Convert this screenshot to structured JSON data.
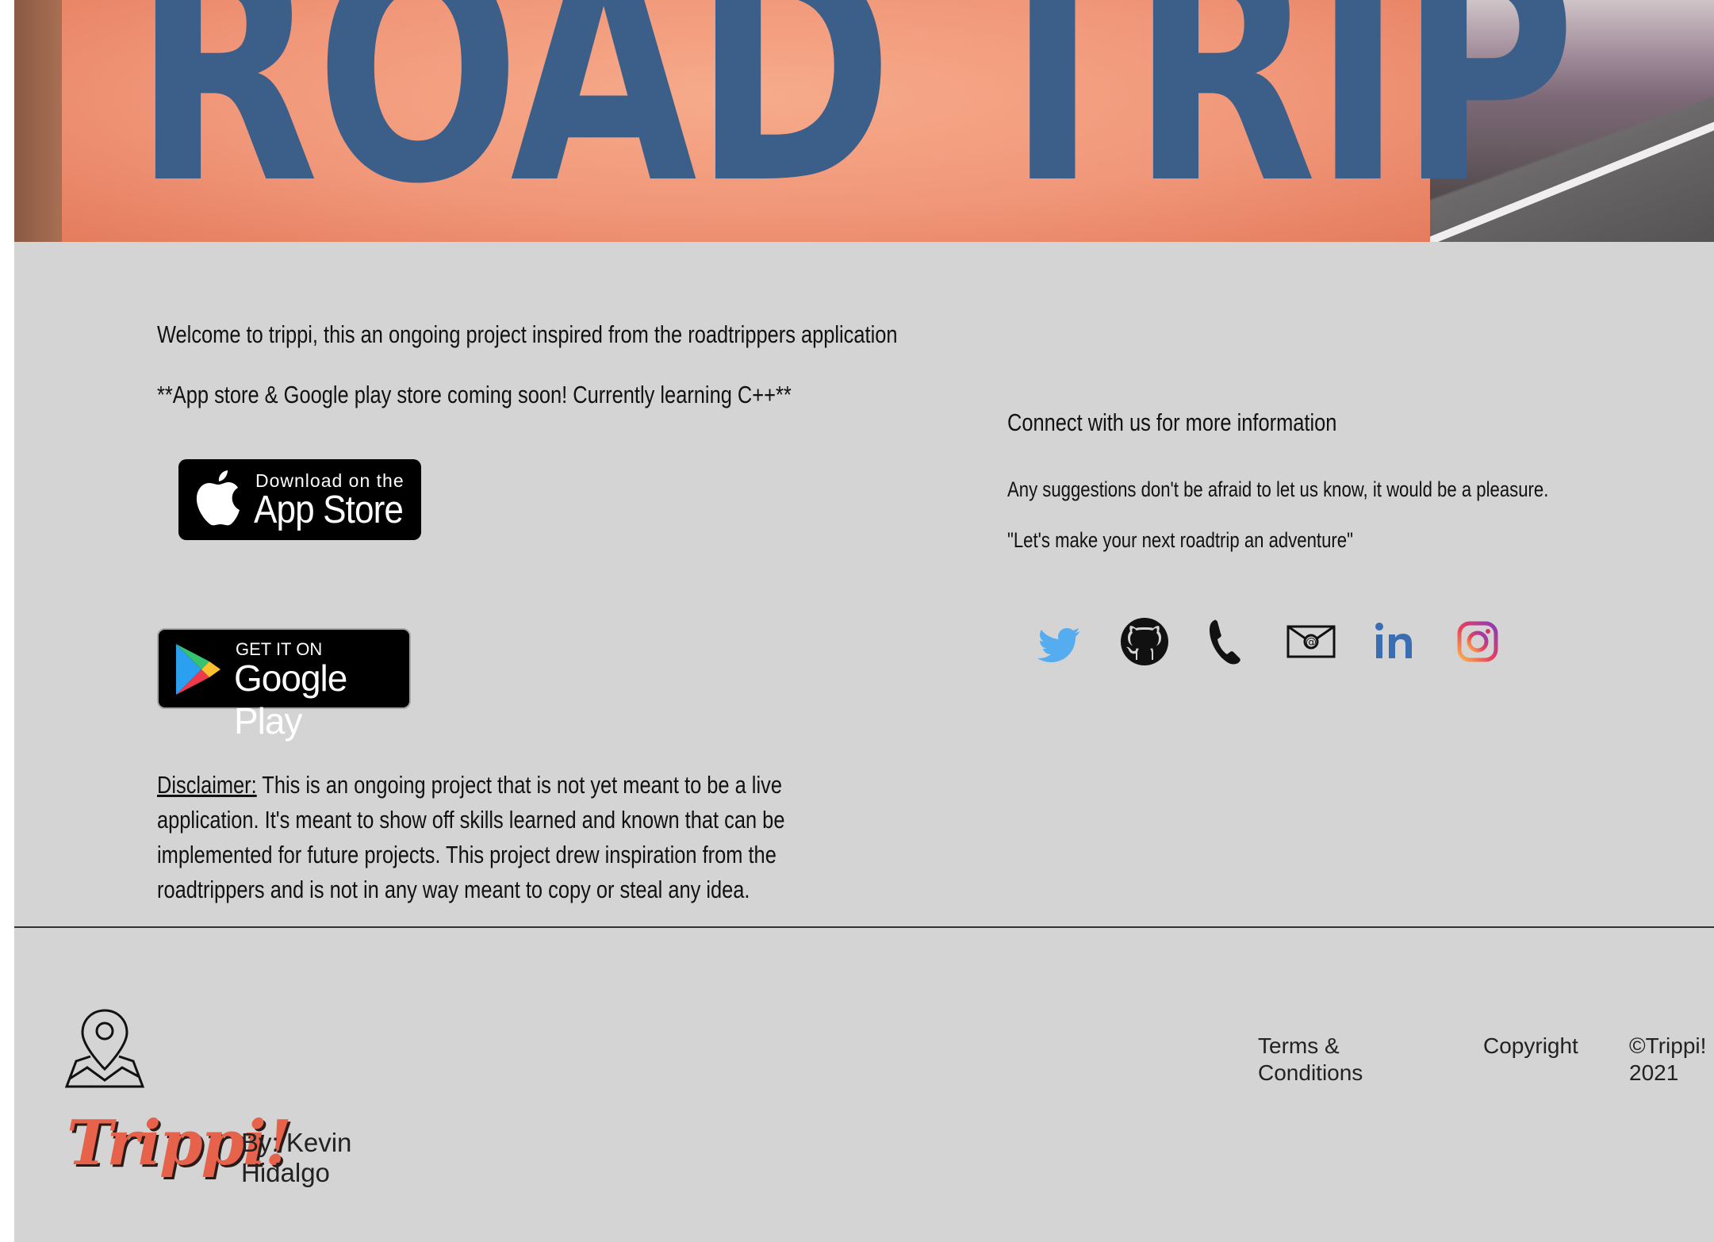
{
  "hero": {
    "banner_text": "ROAD TRIP"
  },
  "intro": {
    "welcome": "Welcome to trippi, this an ongoing project inspired from the roadtrippers application",
    "coming_soon": "**App store & Google play store coming soon! Currently learning C++**"
  },
  "badges": {
    "app_store": {
      "small": "Download on the",
      "big": "App Store"
    },
    "google_play": {
      "small": "GET IT ON",
      "big": "Google Play"
    }
  },
  "disclaimer": {
    "label": "Disclaimer:",
    "text": " This is an ongoing project that is not yet meant to be a live application. It's meant to show off skills learned and known that can be implemented for future projects. This project drew inspiration from the roadtrippers and is not in any way meant to copy or steal any idea."
  },
  "connect": {
    "heading": "Connect with us for more information",
    "suggestions": "Any suggestions don't be afraid to let us know, it would be a pleasure.",
    "quote": "\"Let's make your next roadtrip an adventure\""
  },
  "social": [
    {
      "icon": "twitter-icon",
      "color": "#55acee"
    },
    {
      "icon": "github-icon",
      "color": "#111111"
    },
    {
      "icon": "phone-icon",
      "color": "#111111"
    },
    {
      "icon": "email-icon",
      "color": "#111111"
    },
    {
      "icon": "linkedin-icon",
      "color": "#3b6db3"
    },
    {
      "icon": "instagram-icon",
      "color": "#d6336c"
    }
  ],
  "footer": {
    "brand": "Trippi!",
    "byline": "By: Kevin Hidalgo",
    "terms": "Terms & Conditions",
    "copyright": "Copyright",
    "year": "©Trippi! 2021"
  },
  "colors": {
    "background": "#d4d4d4",
    "brand": "#e7624a",
    "banner_text": "#3b5f88"
  }
}
